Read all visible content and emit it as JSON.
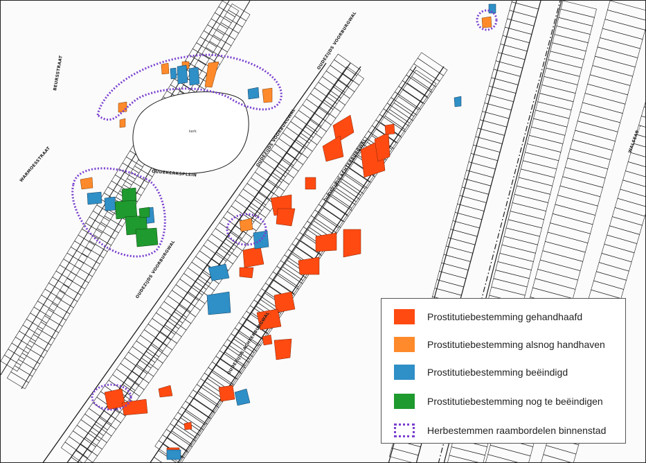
{
  "map": {
    "colors": {
      "gehandhaafd": "#ff4a12",
      "alsnog": "#ff8a2b",
      "beeindigd": "#2f8fc7",
      "nog_te_beeindigen": "#1f9a2e",
      "herbestemmen": "#7a3fd0",
      "lines": "#1c1c1c"
    },
    "labels": {
      "oudezijds_voorburgwal_1": "OUDEZIJDS VOORBURGWAL",
      "oudezijds_voorburgwal_2": "OUDEZIJDS VOORBURGWAL",
      "oudezijds_voorburgwal_3": "OUDEZIJDS VOORBURGWAL",
      "oudezijds_achterburgwal_1": "OUDEZIJDS ACHTERBURGWAL",
      "oudezijds_achterburgwal_2": "OUDEZIJDS ACHTERBURGWAL",
      "oudekerksplein": "OUDEKERKSPLEIN",
      "kerk": "kerk",
      "warmoesstraat": "WARMOESSTRAAT",
      "beursstraat": "BEURSSTRAAT",
      "zeedijk": "ZEEDIJK",
      "walsesteeg": "WALSEAB..."
    }
  },
  "legend": {
    "items": [
      {
        "key": "gehandhaafd",
        "label": "Prostitutiebestemming gehandhaafd",
        "color": "#ff4a12"
      },
      {
        "key": "alsnog",
        "label": "Prostitutiebestemming alsnog handhaven",
        "color": "#ff8a2b"
      },
      {
        "key": "beeindigd",
        "label": "Prostitutiebestemming beëindigd",
        "color": "#2f8fc7"
      },
      {
        "key": "nog_te",
        "label": "Prostitutiebestemming nog te beëindigen",
        "color": "#1f9a2e"
      },
      {
        "key": "herbestemmen",
        "label": "Herbestemmen raambordelen binnenstad",
        "color": "#7a3fd0"
      }
    ]
  }
}
